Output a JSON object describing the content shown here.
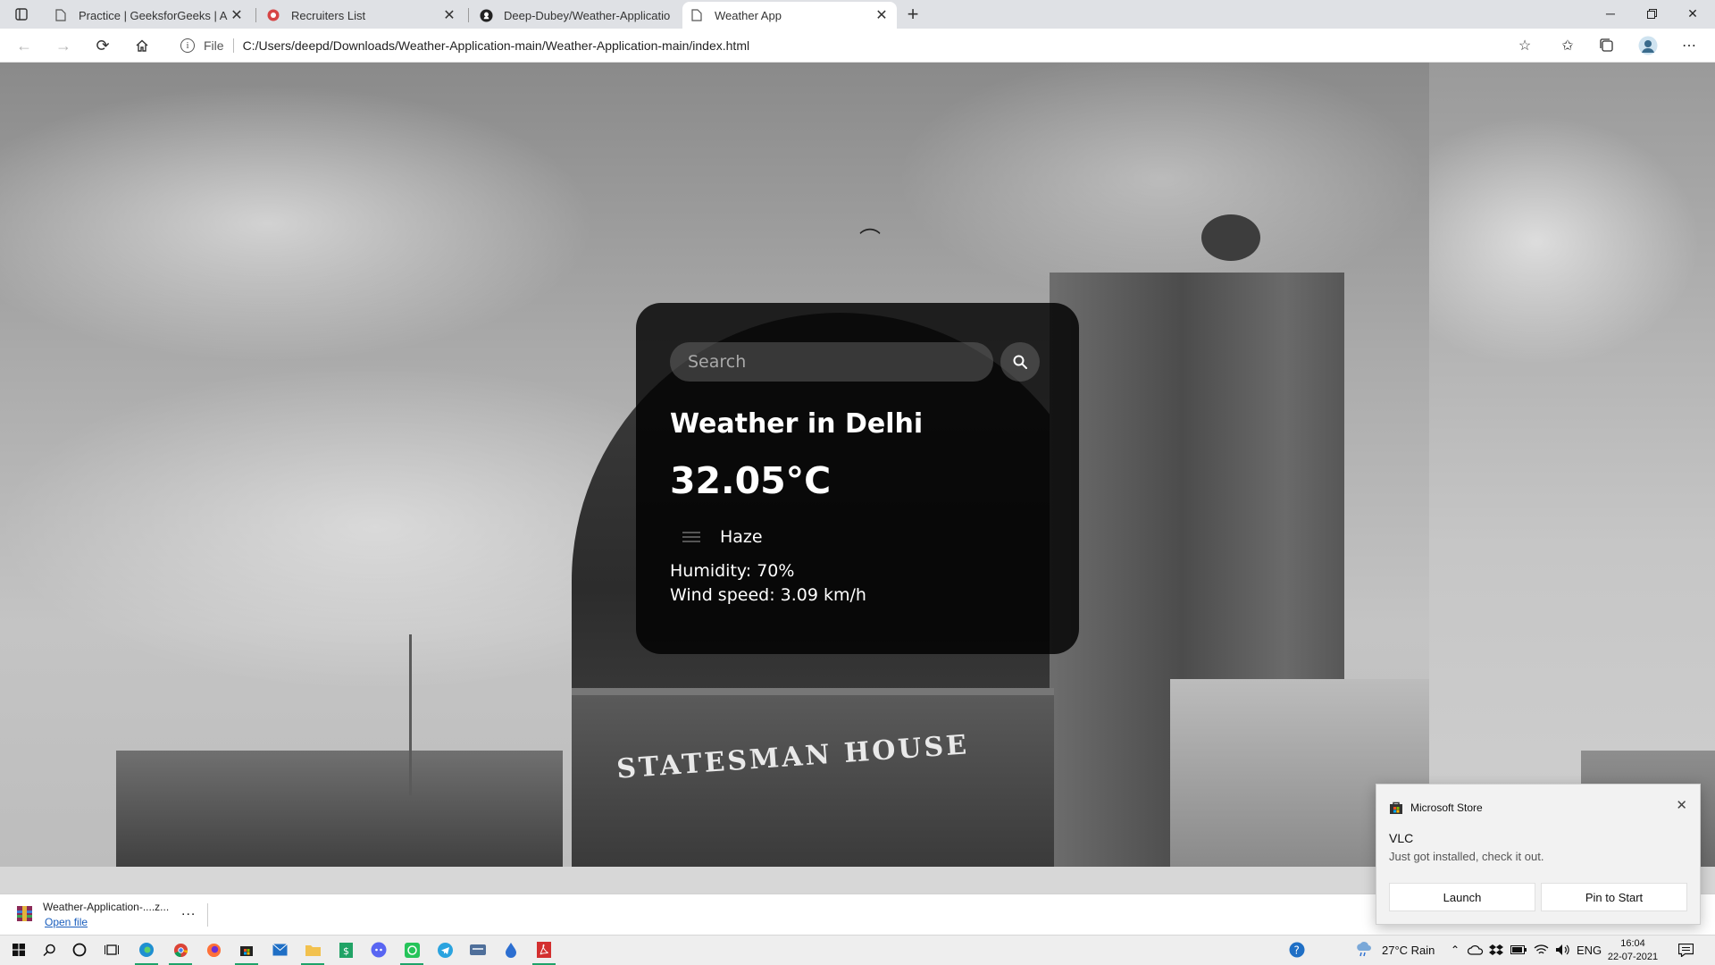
{
  "browser": {
    "tabs": [
      {
        "title": "Practice | GeeksforGeeks | A com",
        "favicon": "page-icon"
      },
      {
        "title": "Recruiters List",
        "favicon": "record-icon"
      },
      {
        "title": "Deep-Dubey/Weather-Applicatio",
        "favicon": "github-icon"
      },
      {
        "title": "Weather App",
        "favicon": "page-icon",
        "active": true
      }
    ],
    "address": {
      "scheme_label": "File",
      "url": "C:/Users/deepd/Downloads/Weather-Application-main/Weather-Application-main/index.html"
    }
  },
  "weather": {
    "search_placeholder": "Search",
    "city_heading": "Weather in Delhi",
    "temperature": "32.05°C",
    "description": "Haze",
    "humidity": "Humidity: 70%",
    "wind": "Wind speed: 3.09 km/h"
  },
  "background": {
    "sign_text": "STATESMAN HOUSE"
  },
  "download": {
    "file_name": "Weather-Application-....z...",
    "open_label": "Open file",
    "more_label": "..."
  },
  "toast": {
    "app_name": "Microsoft Store",
    "title": "VLC",
    "body": "Just got installed, check it out.",
    "launch_label": "Launch",
    "pin_label": "Pin to Start"
  },
  "taskbar": {
    "weather_text": "27°C  Rain",
    "language": "ENG",
    "time": "16:04",
    "date": "22-07-2021"
  },
  "colors": {
    "card_bg": "#000000",
    "link": "#1a5ebd",
    "accent_underline": "#1fa36a"
  }
}
